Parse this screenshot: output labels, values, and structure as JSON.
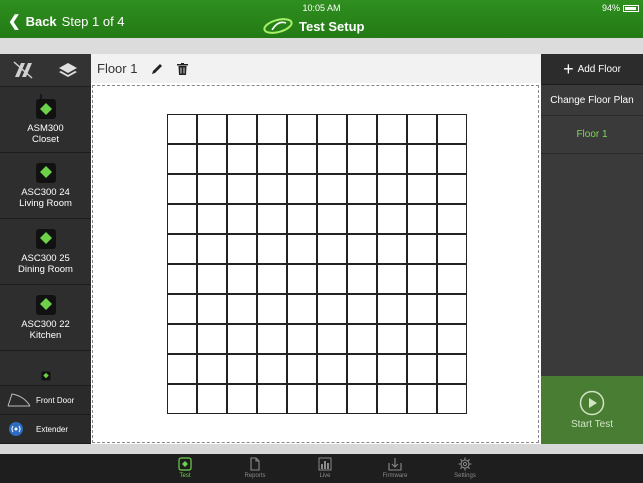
{
  "statusbar": {
    "time": "10:05 AM",
    "battery": "94%"
  },
  "nav": {
    "back_label": "Back",
    "step": "Step 1 of 4",
    "title": "Test Setup"
  },
  "floorbar": {
    "floor_name": "Floor 1"
  },
  "devices": [
    {
      "line1": "ASM300",
      "line2": "Closet"
    },
    {
      "line1": "ASC300 24",
      "line2": "Living Room"
    },
    {
      "line1": "ASC300 25",
      "line2": "Dining Room"
    },
    {
      "line1": "ASC300 22",
      "line2": "Kitchen"
    }
  ],
  "legend": {
    "front_door": "Front Door",
    "extender": "Extender"
  },
  "right_panel": {
    "add_floor": "Add Floor",
    "change_floor_plan": "Change Floor Plan",
    "floors": [
      "Floor 1"
    ],
    "start_test": "Start Test"
  },
  "tabs": [
    {
      "label": "Test",
      "icon": "test-icon",
      "active": true
    },
    {
      "label": "Reports",
      "icon": "document-icon",
      "active": false
    },
    {
      "label": "Live",
      "icon": "bar-chart-icon",
      "active": false
    },
    {
      "label": "Firmware",
      "icon": "download-icon",
      "active": false
    },
    {
      "label": "Settings",
      "icon": "gear-icon",
      "active": false
    }
  ],
  "grid": {
    "rows": 10,
    "columns": 10
  },
  "colors": {
    "accent_green": "#6bd24a",
    "nav_green": "#2f8f1f",
    "start_test_bg": "#4a7d34"
  }
}
